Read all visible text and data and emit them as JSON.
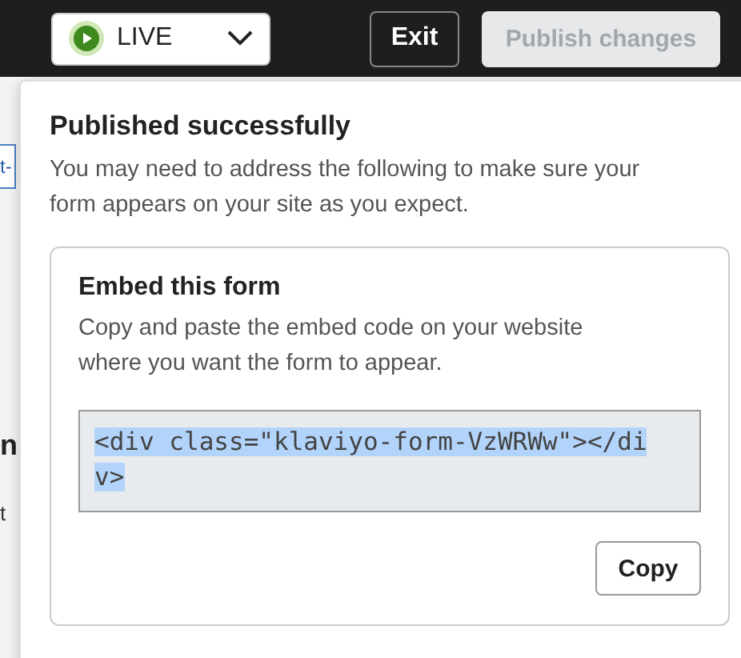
{
  "topbar": {
    "status": {
      "label": "LIVE"
    },
    "exit_button": "Exit",
    "publish_button": {
      "label": "Publish changes",
      "disabled": true
    }
  },
  "background_fragments": [
    "t-",
    "n",
    "t"
  ],
  "popover": {
    "title": "Published successfully",
    "message": "You may need to address the following to make sure your form appears on your site as you expect.",
    "embed": {
      "title": "Embed this form",
      "description": "Copy and paste the embed code on your website where you want the form to appear.",
      "code": "<div class=\"klaviyo-form-VzWRWw\"></div>",
      "selected": true,
      "copy_button": "Copy"
    }
  }
}
